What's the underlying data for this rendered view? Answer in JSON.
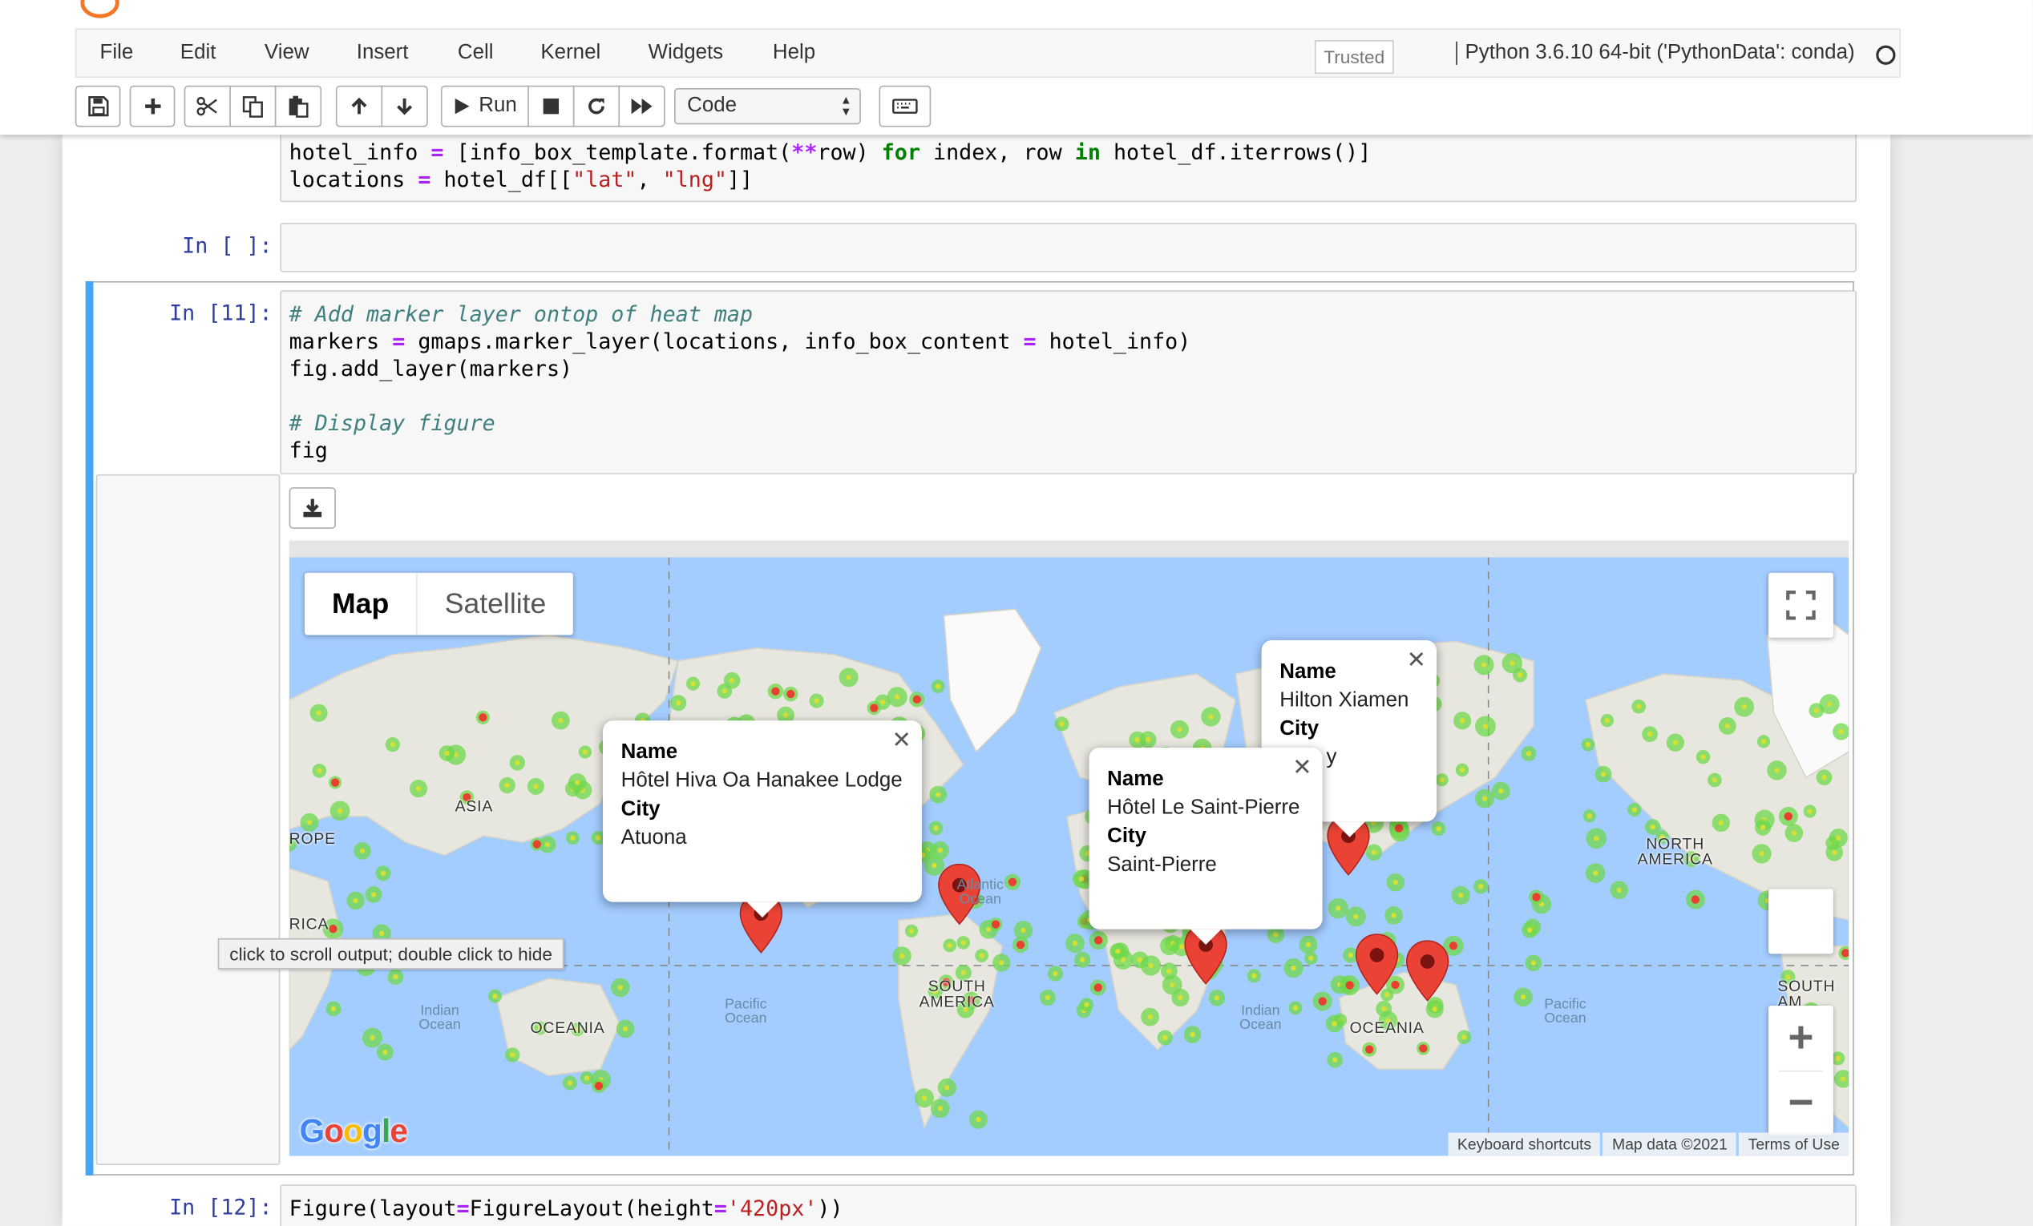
{
  "menu": [
    "File",
    "Edit",
    "View",
    "Insert",
    "Cell",
    "Kernel",
    "Widgets",
    "Help"
  ],
  "trusted_label": "Trusted",
  "kernel_name": "Python 3.6.10 64-bit ('PythonData': conda)",
  "toolbar": {
    "run_label": "Run",
    "cell_type": "Code",
    "icons": [
      "save-icon",
      "plus-icon",
      "scissors-icon",
      "copy-icon",
      "paste-icon",
      "arrow-up-icon",
      "arrow-down-icon",
      "play-icon",
      "stop-icon",
      "restart-icon",
      "fast-forward-icon",
      "keyboard-icon"
    ]
  },
  "cells": {
    "prev": {
      "line1": {
        "a": "hotel_info ",
        "b": "=",
        "c": " [info_box_template.format(",
        "d": "**",
        "e": "row) ",
        "f": "for",
        "g": " index, row ",
        "h": "in",
        "i": " hotel_df.iterrows()]"
      },
      "line2": {
        "a": "locations ",
        "b": "=",
        "c": " hotel_df[[",
        "d": "\"lat\"",
        "e": ", ",
        "f": "\"lng\"",
        "g": "]]"
      }
    },
    "empty": {
      "prompt": "In [ ]:"
    },
    "c11": {
      "prompt": "In [11]:",
      "comment1": "# Add marker layer ontop of heat map",
      "line2": {
        "a": "markers ",
        "b": "=",
        "c": " gmaps.marker_layer(locations, info_box_content ",
        "d": "=",
        "e": " hotel_info)"
      },
      "line3": "fig.add_layer(markers)",
      "comment2": "# Display figure",
      "line5": "fig"
    },
    "c12": {
      "prompt": "In [12]:",
      "line": {
        "a": "Figure(layout",
        "b": "=",
        "c": "FigureLayout(height",
        "d": "=",
        "e": "'420px'",
        "f": "))"
      }
    }
  },
  "output": {
    "scroll_tooltip": "click to scroll output; double click to hide",
    "download_icon": "download-icon"
  },
  "map": {
    "type_map": "Map",
    "type_satellite": "Satellite",
    "google": {
      "G": "G",
      "o1": "o",
      "o2": "o",
      "g": "g",
      "l": "l",
      "e": "e"
    },
    "attribution": {
      "shortcuts": "Keyboard shortcuts",
      "data": "Map data ©2021",
      "terms": "Terms of Use"
    },
    "labels": {
      "asia": "ASIA",
      "europe": "ROPE",
      "africa": "RICA",
      "north_america": "NORTH\nAMERICA",
      "south_america": "SOUTH\nAMERICA",
      "south_america_right": "SOUTH\nAM",
      "oceania_left": "OCEANIA",
      "oceania_right": "OCEANIA",
      "indian_left": "Indian\nOcean",
      "indian_mid": "Indian\nOcean",
      "pacific_left": "Pacific\nOcean",
      "pacific_right": "Pacific\nOcean",
      "atlantic": "Atlantic\nOcean"
    },
    "info_windows": [
      {
        "name_label": "Name",
        "name": "Hôtel Hiva Oa Hanakee Lodge",
        "city_label": "City",
        "city": "Atuona"
      },
      {
        "name_label": "Name",
        "name": "Hôtel Le Saint-Pierre",
        "city_label": "City",
        "city": "Saint-Pierre"
      },
      {
        "name_label": "Name",
        "name": "Hilton Xiamen",
        "city_label": "City",
        "city": "y"
      }
    ],
    "zoom_in": "+",
    "zoom_out": "−",
    "colors": {
      "ocean": "#a3ccff",
      "land": "#e8e7df",
      "marker": "#ea4335",
      "heat_green": "#6fd84b",
      "heat_yellow": "#d4e034",
      "heat_red": "#e8412f"
    }
  }
}
